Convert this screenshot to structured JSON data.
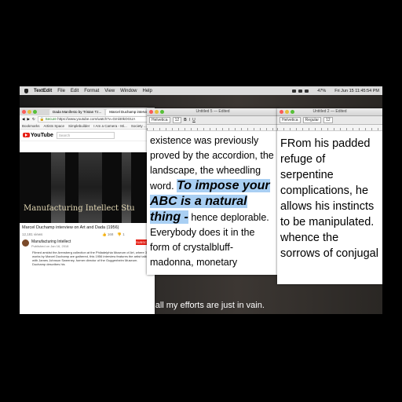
{
  "menubar": {
    "app": "TextEdit",
    "items": [
      "File",
      "Edit",
      "Format",
      "View",
      "Window",
      "Help"
    ],
    "battery": "47%",
    "clock": "Fri Jun 15 11:45:54 PM"
  },
  "subtitles": {
    "line1": "And all my efforts are just in vain."
  },
  "browser": {
    "tabs": [
      "Dada Manifesto by Tristan Tz...",
      "Marcel Duchamp interview..."
    ],
    "secure": "Secure",
    "url": "https://www.youtube.com/watch?v=Gml40kOGUA",
    "bookmarks": [
      "Bookmarks",
      "Artists Space",
      "Simplebuilder",
      "I Am a Camera - Mi...",
      "Society ..."
    ],
    "yt_logo": "YouTube",
    "search_placeholder": "Search",
    "player_overlay": "Manufacturing Intellect Stu",
    "video_title": "Marcel Duchamp interview on Art and Dada (1956)",
    "views": "12,181 views",
    "likes": "168",
    "dislikes": "1",
    "subscribe": "SUBSCRIBE",
    "channel": "Manufacturing Intellect",
    "published": "Published on Jan 16, 2018",
    "description": "Filmed amidst the Arensberg collection at the Philadelphia Museum of Art, where 38 works by Marcel Duchamp are gathered, this 1956 interview features the artist talking with James Johnson Sweeney, former director of the Guggenheim Museum. Duchamp describes his"
  },
  "editor1": {
    "title": "Untitled 5 — Edited",
    "font": "Helvetica",
    "size": "12",
    "text_before": "existence was previously proved by the accordion, the landscape, the wheedling word.",
    "highlight": "To impose your ABC is a natural thing -",
    "text_after": "hence deplorable. Everybody does it in the form of crystalbluff-madonna, monetary"
  },
  "editor2": {
    "title": "Untitled 2 — Edited",
    "font": "Helvetica",
    "style": "Regular",
    "size": "12",
    "text": "FRom his padded refuge of serpentine complications, he allows his instincts to be manipulated. whence the sorrows of conjugal"
  },
  "background_text": {
    "snippet": "his reins all ... after ... And all my efforts are just in vain."
  }
}
